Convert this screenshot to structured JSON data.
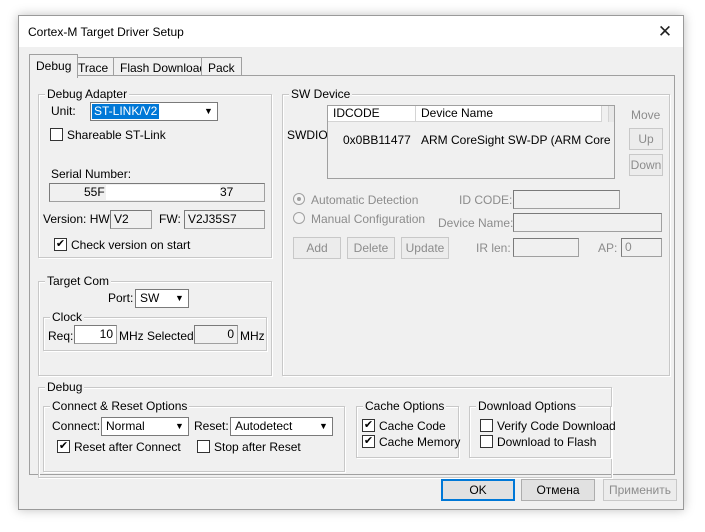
{
  "window": {
    "title": "Cortex-M Target Driver Setup",
    "close_glyph": "✕"
  },
  "tabs": [
    {
      "label": "Debug",
      "active": true
    },
    {
      "label": "Trace",
      "active": false
    },
    {
      "label": "Flash Download",
      "active": false
    },
    {
      "label": "Pack",
      "active": false
    }
  ],
  "debug_adapter": {
    "group_label": "Debug Adapter",
    "unit_label": "Unit:",
    "unit_value": "ST-LINK/V2",
    "shareable_label": "Shareable ST-Link",
    "shareable_checked": false,
    "serial_label": "Serial Number:",
    "serial_value_start": "55F",
    "serial_value_end": "37",
    "version_hw_label": "Version: HW:",
    "version_hw_value": "V2",
    "fw_label": "FW:",
    "fw_value": "V2J35S7",
    "check_version_label": "Check version on start",
    "check_version_checked": true
  },
  "target_com": {
    "group_label": "Target Com",
    "port_label": "Port:",
    "port_value": "SW",
    "clock_group_label": "Clock",
    "req_label": "Req:",
    "req_value": "10",
    "req_unit": "MHz",
    "selected_label": "Selected:",
    "selected_value": "0",
    "selected_unit": "MHz"
  },
  "sw_device": {
    "group_label": "SW Device",
    "swdio_label": "SWDIO",
    "columns": [
      "IDCODE",
      "Device Name"
    ],
    "rows": [
      {
        "idcode": "0x0BB11477",
        "device_name": "ARM CoreSight SW-DP (ARM Core"
      }
    ],
    "move_label": "Move",
    "up_label": "Up",
    "down_label": "Down",
    "auto_detect_label": "Automatic Detection",
    "manual_config_label": "Manual Configuration",
    "id_code_label": "ID CODE:",
    "device_name_label": "Device Name:",
    "ir_len_label": "IR len:",
    "ap_label": "AP:",
    "ap_value": "0",
    "add_label": "Add",
    "delete_label": "Delete",
    "update_label": "Update"
  },
  "debug": {
    "group_label": "Debug",
    "connect_reset_label": "Connect & Reset Options",
    "connect_label": "Connect:",
    "connect_value": "Normal",
    "reset_label": "Reset:",
    "reset_value": "Autodetect",
    "reset_after_connect_label": "Reset after Connect",
    "reset_after_connect_checked": true,
    "stop_after_reset_label": "Stop after Reset",
    "stop_after_reset_checked": false,
    "cache_options_label": "Cache Options",
    "cache_code_label": "Cache Code",
    "cache_code_checked": true,
    "cache_memory_label": "Cache Memory",
    "cache_memory_checked": true,
    "download_options_label": "Download Options",
    "verify_label": "Verify Code Download",
    "verify_checked": false,
    "download_flash_label": "Download to Flash",
    "download_flash_checked": false
  },
  "footer": {
    "ok_label": "OK",
    "cancel_label": "Отмена",
    "apply_label": "Применить"
  },
  "glyphs": {
    "check": "✔",
    "dropdown": "▼"
  }
}
